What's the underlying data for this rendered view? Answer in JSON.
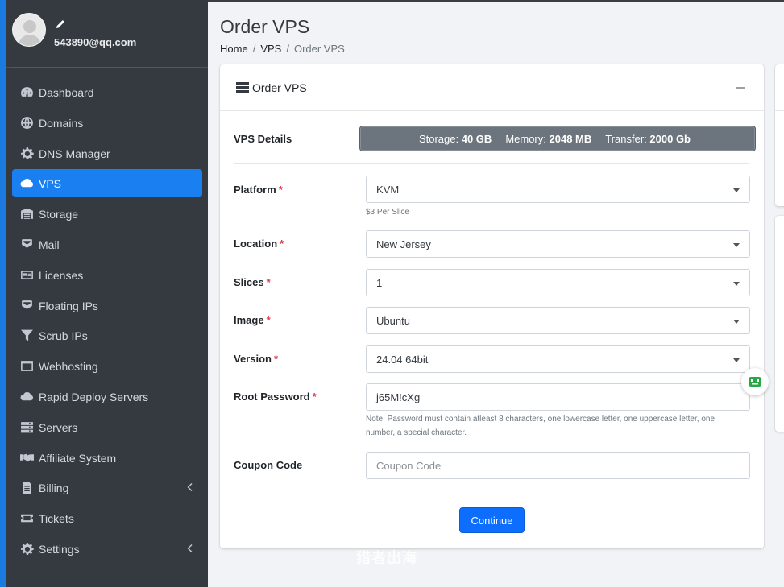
{
  "user": {
    "email": "543890@qq.com"
  },
  "sidebar": {
    "items": [
      {
        "label": "Dashboard",
        "icon": "tachometer-icon"
      },
      {
        "label": "Domains",
        "icon": "globe-icon"
      },
      {
        "label": "DNS Manager",
        "icon": "gear-icon"
      },
      {
        "label": "VPS",
        "icon": "cloud-icon",
        "active": true
      },
      {
        "label": "Storage",
        "icon": "warehouse-icon"
      },
      {
        "label": "Mail",
        "icon": "envelope-icon"
      },
      {
        "label": "Licenses",
        "icon": "id-card-icon"
      },
      {
        "label": "Floating IPs",
        "icon": "envelope-open-icon"
      },
      {
        "label": "Scrub IPs",
        "icon": "filter-icon"
      },
      {
        "label": "Webhosting",
        "icon": "window-icon"
      },
      {
        "label": "Rapid Deploy Servers",
        "icon": "cloud-icon"
      },
      {
        "label": "Servers",
        "icon": "server-icon"
      },
      {
        "label": "Affiliate System",
        "icon": "handshake-icon"
      },
      {
        "label": "Billing",
        "icon": "file-invoice-icon",
        "has_submenu": true
      },
      {
        "label": "Tickets",
        "icon": "ticket-icon"
      },
      {
        "label": "Settings",
        "icon": "gear-icon",
        "has_submenu": true
      }
    ]
  },
  "header": {
    "title": "Order VPS",
    "breadcrumb": [
      "Home",
      "VPS",
      "Order VPS"
    ],
    "separator": "/"
  },
  "card": {
    "title": "Order VPS",
    "details_label": "VPS Details",
    "details": {
      "storage_label": "Storage:",
      "storage_value": "40 GB",
      "memory_label": "Memory:",
      "memory_value": "2048 MB",
      "transfer_label": "Transfer:",
      "transfer_value": "2000 Gb"
    },
    "required_mark": "*",
    "platform": {
      "label": "Platform",
      "value": "KVM",
      "help": "$3 Per Slice"
    },
    "location": {
      "label": "Location",
      "value": "New Jersey"
    },
    "slices": {
      "label": "Slices",
      "value": "1"
    },
    "image": {
      "label": "Image",
      "value": "Ubuntu"
    },
    "version": {
      "label": "Version",
      "value": "24.04 64bit"
    },
    "password": {
      "label": "Root Password",
      "value": "j65M!cXg",
      "note": "Note: Password must contain atleast 8 characters, one lowercase letter, one uppercase letter, one number, a special character."
    },
    "coupon": {
      "label": "Coupon Code",
      "placeholder": "Coupon Code"
    },
    "continue_label": "Continue"
  },
  "watermark": "猎者出海",
  "colors": {
    "sidebar_bg": "#343a40",
    "active_bg": "#1a7ff0",
    "primary": "#0d6efd",
    "required": "#dc3545"
  }
}
